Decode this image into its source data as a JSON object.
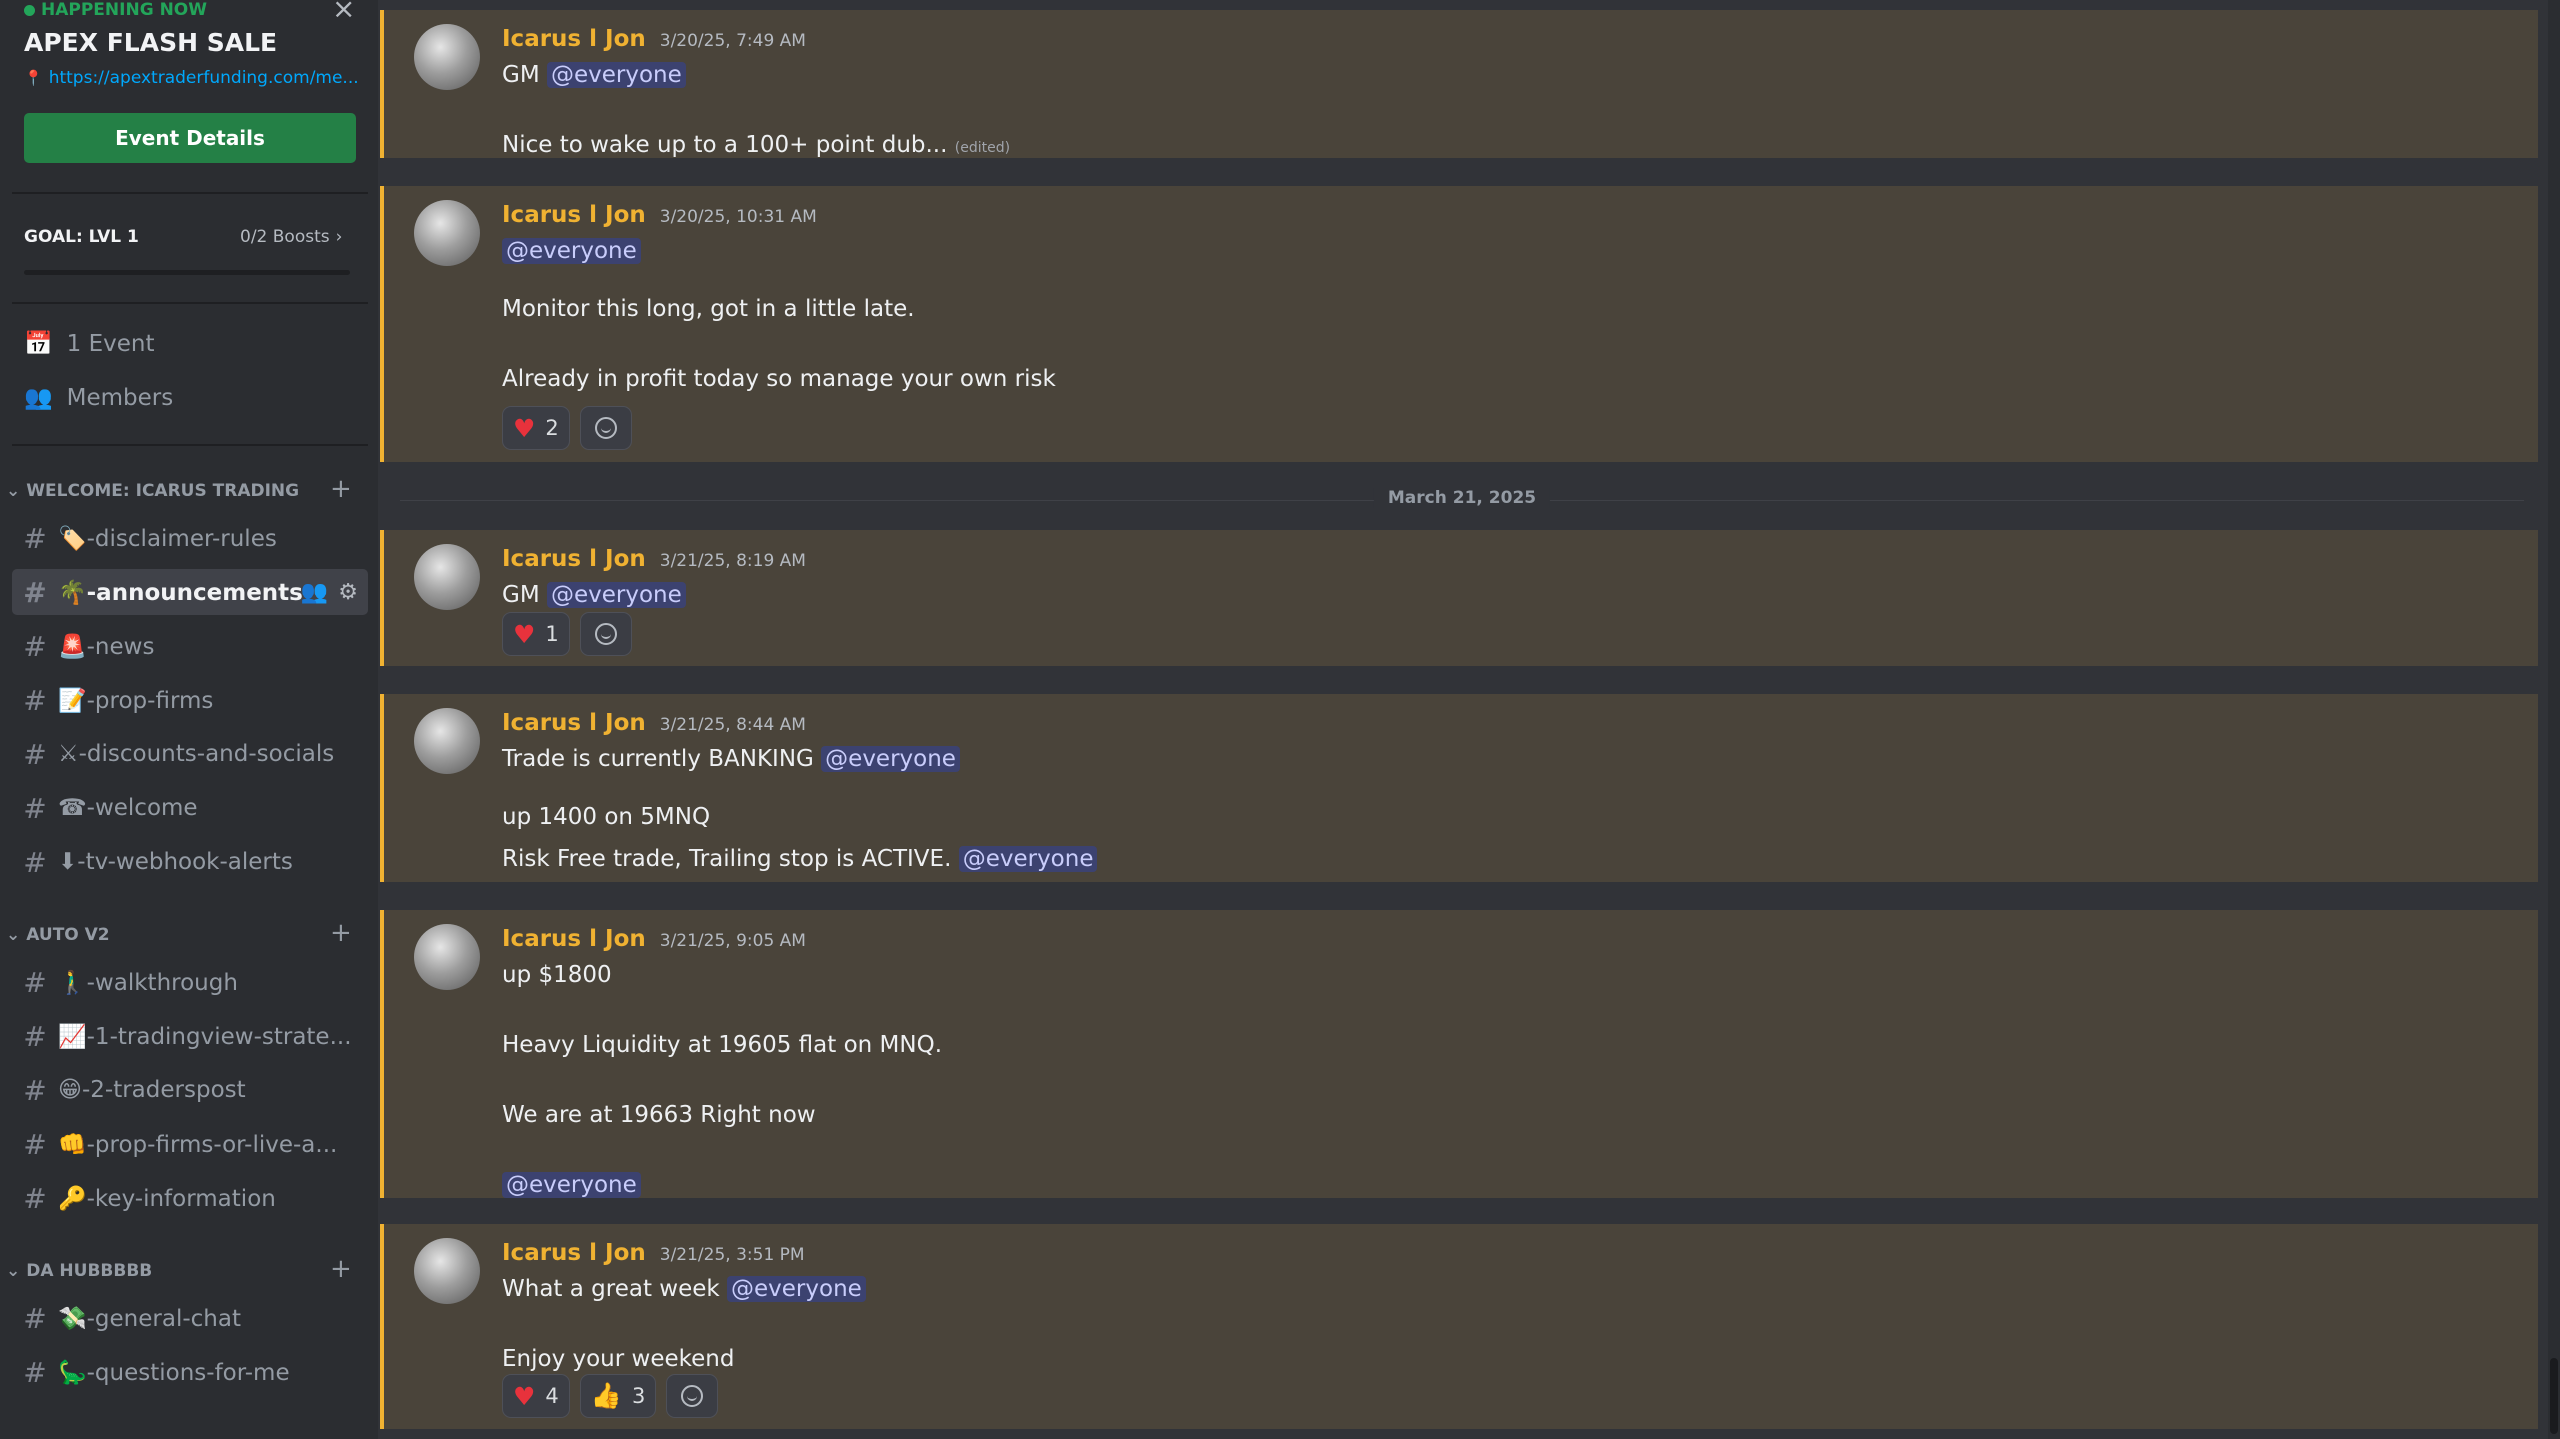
{
  "event": {
    "status": "HAPPENING NOW",
    "title": "APEX FLASH SALE",
    "link": "https://apextraderfunding.com/me...",
    "button": "Event Details"
  },
  "goal": {
    "label": "GOAL: LVL 1",
    "boosts": "0/2 Boosts",
    "progress": 0
  },
  "utilities": {
    "events": "1 Event",
    "members": "Members"
  },
  "categories": {
    "welcome": {
      "name": "WELCOME: ICARUS TRADING",
      "channels": [
        "🏷️-disclaimer-rules",
        "🌴-announcements",
        "🚨-news",
        "📝-prop-firms",
        "⚔-discounts-and-socials",
        "☎-welcome",
        "⬇-tv-webhook-alerts"
      ]
    },
    "auto": {
      "name": "AUTO V2",
      "channels": [
        "🚶‍♂️-walkthrough",
        "📈-1-tradingview-strate...",
        "😁-2-traderspost",
        "👊-prop-firms-or-live-a...",
        "🔑-key-information"
      ]
    },
    "hub": {
      "name": "DA HUBBBBB",
      "channels": [
        "💸-general-chat",
        "🦕-questions-for-me"
      ]
    }
  },
  "date_divider": "March 21, 2025",
  "messages": [
    {
      "author": "Icarus l Jon",
      "time": "3/20/25, 7:49 AM",
      "l1": "GM",
      "m1": "@everyone",
      "l2": "Nice to wake up to a 100+ point dub...",
      "edited": "(edited)"
    },
    {
      "author": "Icarus l Jon",
      "time": "3/20/25, 10:31 AM",
      "m1": "@everyone",
      "l2": "Monitor this long, got in a little late.",
      "l3": "Already in profit today so manage your own risk",
      "r_heart": "2"
    },
    {
      "author": "Icarus l Jon",
      "time": "3/21/25, 8:19 AM",
      "l1": "GM",
      "m1": "@everyone",
      "r_heart": "1"
    },
    {
      "author": "Icarus l Jon",
      "time": "3/21/25, 8:44 AM",
      "l1": "Trade is currently BANKING",
      "m1": "@everyone",
      "l2": "up 1400 on 5MNQ",
      "l3": "Risk Free trade, Trailing stop is ACTIVE.",
      "m3": "@everyone"
    },
    {
      "author": "Icarus l Jon",
      "time": "3/21/25, 9:05 AM",
      "l1": "up $1800",
      "l2": "Heavy Liquidity at 19605 flat on MNQ.",
      "l3": "We are at 19663 Right now",
      "m4": "@everyone"
    },
    {
      "author": "Icarus l Jon",
      "time": "3/21/25, 3:51 PM",
      "l1": "What a great week",
      "m1": "@everyone",
      "l2": "Enjoy your weekend",
      "r_heart": "4",
      "r_thumb": "3"
    }
  ]
}
